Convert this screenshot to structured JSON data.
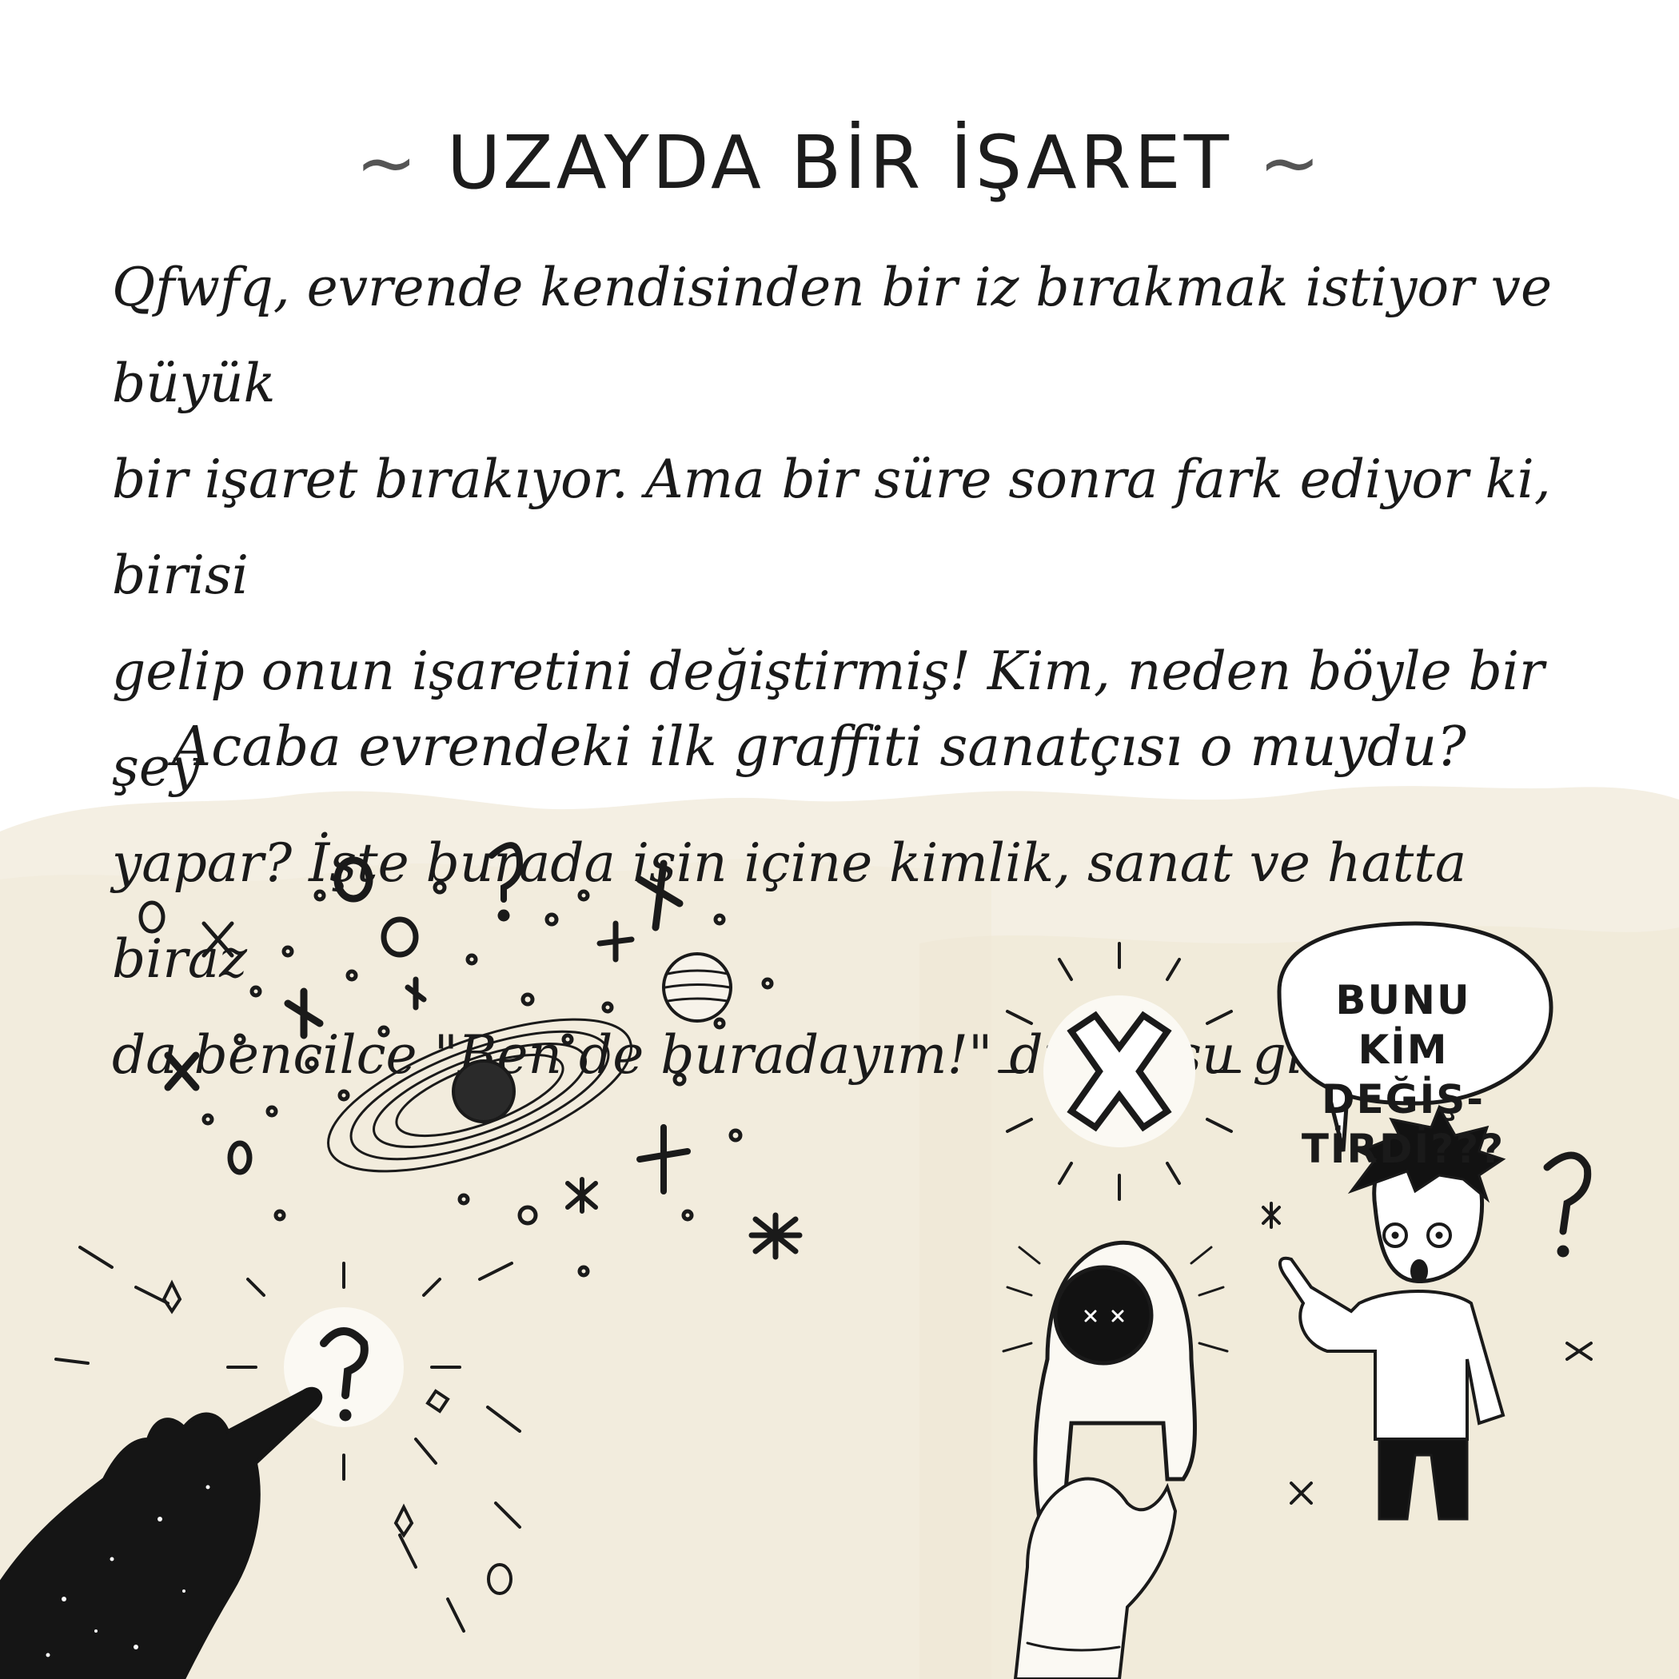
{
  "title": {
    "left_tilde": "~",
    "text": "UZAYDA BİR İŞARET",
    "right_tilde": "~"
  },
  "paragraph": {
    "lines": [
      "Qfwfq, evrende kendisinden bir iz bırakmak istiyor ve büyük",
      "bir işaret bırakıyor. Ama bir süre sonra fark ediyor ki, birisi",
      "gelip onun işaretini değiştirmiş! Kim, neden böyle bir şey",
      "yapar? İşte burada işin içine kimlik, sanat ve hatta biraz",
      "da bencilce \"Ben de buradayım!\" duygusu giriyor..."
    ]
  },
  "question": "Acaba evrendeki ilk graffiti sanatçısı o muydu?",
  "speech_bubble": {
    "lines": [
      "BUNU",
      "KİM DEĞİŞ-",
      "TİRDİ???"
    ]
  },
  "icons": {
    "galaxy": "spiral-galaxy-icon",
    "planet": "striped-planet-icon",
    "hand": "starry-hand-icon",
    "glowing_question": "glowing-question-mark-icon",
    "glowing_x": "glowing-x-sign-icon",
    "astronaut": "astronaut-icon",
    "boy": "surprised-boy-icon"
  },
  "colors": {
    "background": "#ffffff",
    "wash": "#f4efe3",
    "ink": "#1a1a1a"
  }
}
